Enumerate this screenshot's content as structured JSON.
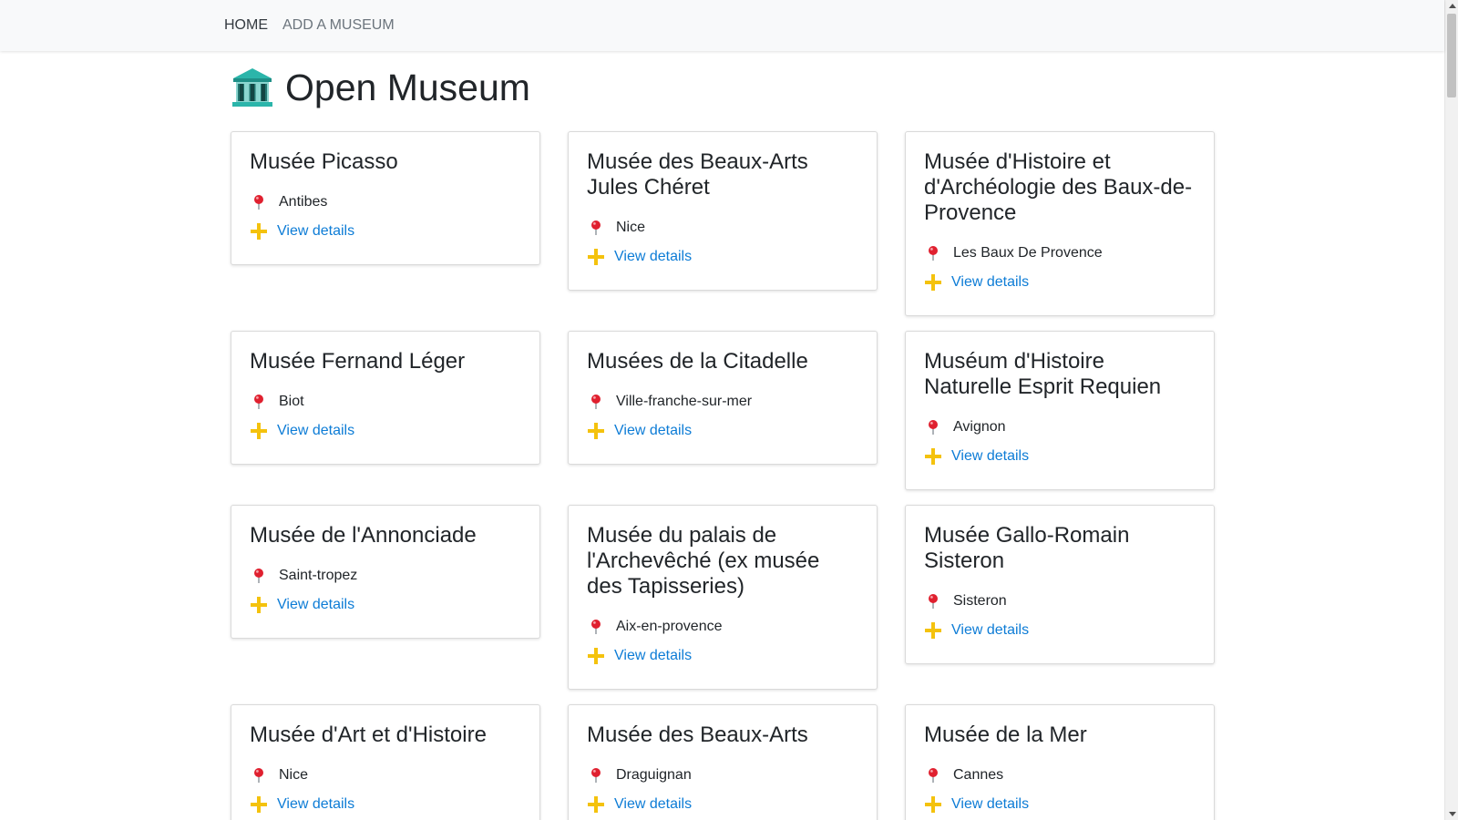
{
  "nav": {
    "home_label": "HOME",
    "add_label": "ADD A MUSEUM"
  },
  "header": {
    "title": "Open Museum",
    "icon": "classical-building-icon"
  },
  "museums": [
    {
      "name": "Musée Picasso",
      "city": "Antibes",
      "link_label": "View details"
    },
    {
      "name": "Musée des Beaux-Arts Jules Chéret",
      "city": "Nice",
      "link_label": "View details"
    },
    {
      "name": "Musée d'Histoire et d'Archéologie des Baux-de-Provence",
      "city": "Les Baux De Provence",
      "link_label": "View details"
    },
    {
      "name": "Musée Fernand Léger",
      "city": "Biot",
      "link_label": "View details"
    },
    {
      "name": "Musées de la Citadelle",
      "city": "Ville-franche-sur-mer",
      "link_label": "View details"
    },
    {
      "name": "Muséum d'Histoire Naturelle Esprit Requien",
      "city": "Avignon",
      "link_label": "View details"
    },
    {
      "name": "Musée de l'Annonciade",
      "city": "Saint-tropez",
      "link_label": "View details"
    },
    {
      "name": "Musée du palais de l'Archevêché (ex musée des Tapisseries)",
      "city": "Aix-en-provence",
      "link_label": "View details"
    },
    {
      "name": "Musée Gallo-Romain Sisteron",
      "city": "Sisteron",
      "link_label": "View details"
    },
    {
      "name": "Musée d'Art et d'Histoire",
      "city": "Nice",
      "link_label": "View details"
    },
    {
      "name": "Musée des Beaux-Arts",
      "city": "Draguignan",
      "link_label": "View details"
    },
    {
      "name": "Musée de la Mer",
      "city": "Cannes",
      "link_label": "View details"
    }
  ],
  "icons": {
    "location": "round-pushpin-icon",
    "details": "plus-icon"
  },
  "colors": {
    "link": "#0d7cd6",
    "pin": "#e0202f",
    "plus": "#f4c20d",
    "building": "#2bb5aa"
  }
}
